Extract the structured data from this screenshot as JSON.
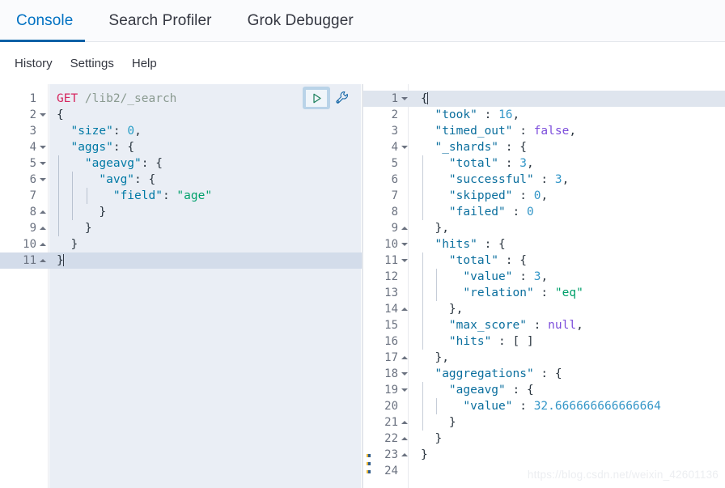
{
  "tabs": [
    {
      "label": "Console",
      "active": true
    },
    {
      "label": "Search Profiler",
      "active": false
    },
    {
      "label": "Grok Debugger",
      "active": false
    }
  ],
  "submenu": [
    {
      "label": "History"
    },
    {
      "label": "Settings"
    },
    {
      "label": "Help"
    }
  ],
  "actions": {
    "play_icon": "play-triangle-icon",
    "wrench_icon": "wrench-icon"
  },
  "divider": {
    "handle_icon": "drag-handle-icon"
  },
  "request_editor": {
    "name": "request-editor",
    "active_line": 11,
    "lines": [
      {
        "n": "1",
        "fold": "none",
        "indent": 0,
        "active": false,
        "tokens": [
          {
            "t": "GET ",
            "c": "k-method"
          },
          {
            "t": "/lib2/_search",
            "c": "k-url"
          }
        ]
      },
      {
        "n": "2",
        "fold": "down",
        "indent": 0,
        "active": false,
        "tokens": [
          {
            "t": "{",
            "c": "k-punct"
          }
        ]
      },
      {
        "n": "3",
        "fold": "none",
        "indent": 0,
        "active": false,
        "tokens": [
          {
            "t": "  ",
            "c": "k-punct"
          },
          {
            "t": "\"size\"",
            "c": "k-key"
          },
          {
            "t": ": ",
            "c": "k-punct"
          },
          {
            "t": "0",
            "c": "k-num"
          },
          {
            "t": ",",
            "c": "k-punct"
          }
        ]
      },
      {
        "n": "4",
        "fold": "down",
        "indent": 0,
        "active": false,
        "tokens": [
          {
            "t": "  ",
            "c": "k-punct"
          },
          {
            "t": "\"aggs\"",
            "c": "k-key"
          },
          {
            "t": ": {",
            "c": "k-punct"
          }
        ]
      },
      {
        "n": "5",
        "fold": "down",
        "indent": 1,
        "active": false,
        "tokens": [
          {
            "t": "    ",
            "c": "k-punct"
          },
          {
            "t": "\"ageavg\"",
            "c": "k-key"
          },
          {
            "t": ": {",
            "c": "k-punct"
          }
        ]
      },
      {
        "n": "6",
        "fold": "down",
        "indent": 2,
        "active": false,
        "tokens": [
          {
            "t": "      ",
            "c": "k-punct"
          },
          {
            "t": "\"avg\"",
            "c": "k-key"
          },
          {
            "t": ": {",
            "c": "k-punct"
          }
        ]
      },
      {
        "n": "7",
        "fold": "none",
        "indent": 3,
        "active": false,
        "tokens": [
          {
            "t": "        ",
            "c": "k-punct"
          },
          {
            "t": "\"field\"",
            "c": "k-key"
          },
          {
            "t": ": ",
            "c": "k-punct"
          },
          {
            "t": "\"age\"",
            "c": "k-str"
          }
        ]
      },
      {
        "n": "8",
        "fold": "up",
        "indent": 2,
        "active": false,
        "tokens": [
          {
            "t": "      }",
            "c": "k-punct"
          }
        ]
      },
      {
        "n": "9",
        "fold": "up",
        "indent": 1,
        "active": false,
        "tokens": [
          {
            "t": "    }",
            "c": "k-punct"
          }
        ]
      },
      {
        "n": "10",
        "fold": "up",
        "indent": 0,
        "active": false,
        "tokens": [
          {
            "t": "  }",
            "c": "k-punct"
          }
        ]
      },
      {
        "n": "11",
        "fold": "up",
        "indent": 0,
        "active": true,
        "caret": true,
        "tokens": [
          {
            "t": "}",
            "c": "k-punct"
          }
        ]
      }
    ]
  },
  "response_editor": {
    "name": "response-viewer",
    "active_line": 1,
    "lines": [
      {
        "n": "1",
        "fold": "down",
        "indent": 0,
        "active": true,
        "caret": true,
        "tokens": [
          {
            "t": "{",
            "c": "k-punct"
          }
        ]
      },
      {
        "n": "2",
        "fold": "none",
        "indent": 0,
        "active": false,
        "tokens": [
          {
            "t": "  ",
            "c": "k-punct"
          },
          {
            "t": "\"took\"",
            "c": "k-rkey"
          },
          {
            "t": " : ",
            "c": "k-punct"
          },
          {
            "t": "16",
            "c": "k-rnum"
          },
          {
            "t": ",",
            "c": "k-punct"
          }
        ]
      },
      {
        "n": "3",
        "fold": "none",
        "indent": 0,
        "active": false,
        "tokens": [
          {
            "t": "  ",
            "c": "k-punct"
          },
          {
            "t": "\"timed_out\"",
            "c": "k-rkey"
          },
          {
            "t": " : ",
            "c": "k-punct"
          },
          {
            "t": "false",
            "c": "k-lit"
          },
          {
            "t": ",",
            "c": "k-punct"
          }
        ]
      },
      {
        "n": "4",
        "fold": "down",
        "indent": 0,
        "active": false,
        "tokens": [
          {
            "t": "  ",
            "c": "k-punct"
          },
          {
            "t": "\"_shards\"",
            "c": "k-rkey"
          },
          {
            "t": " : {",
            "c": "k-punct"
          }
        ]
      },
      {
        "n": "5",
        "fold": "none",
        "indent": 1,
        "active": false,
        "tokens": [
          {
            "t": "    ",
            "c": "k-punct"
          },
          {
            "t": "\"total\"",
            "c": "k-rkey"
          },
          {
            "t": " : ",
            "c": "k-punct"
          },
          {
            "t": "3",
            "c": "k-rnum"
          },
          {
            "t": ",",
            "c": "k-punct"
          }
        ]
      },
      {
        "n": "6",
        "fold": "none",
        "indent": 1,
        "active": false,
        "tokens": [
          {
            "t": "    ",
            "c": "k-punct"
          },
          {
            "t": "\"successful\"",
            "c": "k-rkey"
          },
          {
            "t": " : ",
            "c": "k-punct"
          },
          {
            "t": "3",
            "c": "k-rnum"
          },
          {
            "t": ",",
            "c": "k-punct"
          }
        ]
      },
      {
        "n": "7",
        "fold": "none",
        "indent": 1,
        "active": false,
        "tokens": [
          {
            "t": "    ",
            "c": "k-punct"
          },
          {
            "t": "\"skipped\"",
            "c": "k-rkey"
          },
          {
            "t": " : ",
            "c": "k-punct"
          },
          {
            "t": "0",
            "c": "k-rnum"
          },
          {
            "t": ",",
            "c": "k-punct"
          }
        ]
      },
      {
        "n": "8",
        "fold": "none",
        "indent": 1,
        "active": false,
        "tokens": [
          {
            "t": "    ",
            "c": "k-punct"
          },
          {
            "t": "\"failed\"",
            "c": "k-rkey"
          },
          {
            "t": " : ",
            "c": "k-punct"
          },
          {
            "t": "0",
            "c": "k-rnum"
          }
        ]
      },
      {
        "n": "9",
        "fold": "up",
        "indent": 0,
        "active": false,
        "tokens": [
          {
            "t": "  },",
            "c": "k-punct"
          }
        ]
      },
      {
        "n": "10",
        "fold": "down",
        "indent": 0,
        "active": false,
        "tokens": [
          {
            "t": "  ",
            "c": "k-punct"
          },
          {
            "t": "\"hits\"",
            "c": "k-rkey"
          },
          {
            "t": " : {",
            "c": "k-punct"
          }
        ]
      },
      {
        "n": "11",
        "fold": "down",
        "indent": 1,
        "active": false,
        "tokens": [
          {
            "t": "    ",
            "c": "k-punct"
          },
          {
            "t": "\"total\"",
            "c": "k-rkey"
          },
          {
            "t": " : {",
            "c": "k-punct"
          }
        ]
      },
      {
        "n": "12",
        "fold": "none",
        "indent": 2,
        "active": false,
        "tokens": [
          {
            "t": "      ",
            "c": "k-punct"
          },
          {
            "t": "\"value\"",
            "c": "k-rkey"
          },
          {
            "t": " : ",
            "c": "k-punct"
          },
          {
            "t": "3",
            "c": "k-rnum"
          },
          {
            "t": ",",
            "c": "k-punct"
          }
        ]
      },
      {
        "n": "13",
        "fold": "none",
        "indent": 2,
        "active": false,
        "tokens": [
          {
            "t": "      ",
            "c": "k-punct"
          },
          {
            "t": "\"relation\"",
            "c": "k-rkey"
          },
          {
            "t": " : ",
            "c": "k-punct"
          },
          {
            "t": "\"eq\"",
            "c": "k-str"
          }
        ]
      },
      {
        "n": "14",
        "fold": "up",
        "indent": 1,
        "active": false,
        "tokens": [
          {
            "t": "    },",
            "c": "k-punct"
          }
        ]
      },
      {
        "n": "15",
        "fold": "none",
        "indent": 1,
        "active": false,
        "tokens": [
          {
            "t": "    ",
            "c": "k-punct"
          },
          {
            "t": "\"max_score\"",
            "c": "k-rkey"
          },
          {
            "t": " : ",
            "c": "k-punct"
          },
          {
            "t": "null",
            "c": "k-lit"
          },
          {
            "t": ",",
            "c": "k-punct"
          }
        ]
      },
      {
        "n": "16",
        "fold": "none",
        "indent": 1,
        "active": false,
        "tokens": [
          {
            "t": "    ",
            "c": "k-punct"
          },
          {
            "t": "\"hits\"",
            "c": "k-rkey"
          },
          {
            "t": " : [ ]",
            "c": "k-punct"
          }
        ]
      },
      {
        "n": "17",
        "fold": "up",
        "indent": 0,
        "active": false,
        "tokens": [
          {
            "t": "  },",
            "c": "k-punct"
          }
        ]
      },
      {
        "n": "18",
        "fold": "down",
        "indent": 0,
        "active": false,
        "tokens": [
          {
            "t": "  ",
            "c": "k-punct"
          },
          {
            "t": "\"aggregations\"",
            "c": "k-rkey"
          },
          {
            "t": " : {",
            "c": "k-punct"
          }
        ]
      },
      {
        "n": "19",
        "fold": "down",
        "indent": 1,
        "active": false,
        "tokens": [
          {
            "t": "    ",
            "c": "k-punct"
          },
          {
            "t": "\"ageavg\"",
            "c": "k-rkey"
          },
          {
            "t": " : {",
            "c": "k-punct"
          }
        ]
      },
      {
        "n": "20",
        "fold": "none",
        "indent": 2,
        "active": false,
        "tokens": [
          {
            "t": "      ",
            "c": "k-punct"
          },
          {
            "t": "\"value\"",
            "c": "k-rkey"
          },
          {
            "t": " : ",
            "c": "k-punct"
          },
          {
            "t": "32.666666666666664",
            "c": "k-rnum"
          }
        ]
      },
      {
        "n": "21",
        "fold": "up",
        "indent": 1,
        "active": false,
        "tokens": [
          {
            "t": "    }",
            "c": "k-punct"
          }
        ]
      },
      {
        "n": "22",
        "fold": "up",
        "indent": 0,
        "active": false,
        "tokens": [
          {
            "t": "  }",
            "c": "k-punct"
          }
        ]
      },
      {
        "n": "23",
        "fold": "up",
        "indent": 0,
        "active": false,
        "tokens": [
          {
            "t": "}",
            "c": "k-punct"
          }
        ]
      },
      {
        "n": "24",
        "fold": "none",
        "indent": 0,
        "active": false,
        "tokens": []
      }
    ]
  },
  "watermark": {
    "text": "https://blog.csdn.net/weixin_42601136"
  }
}
